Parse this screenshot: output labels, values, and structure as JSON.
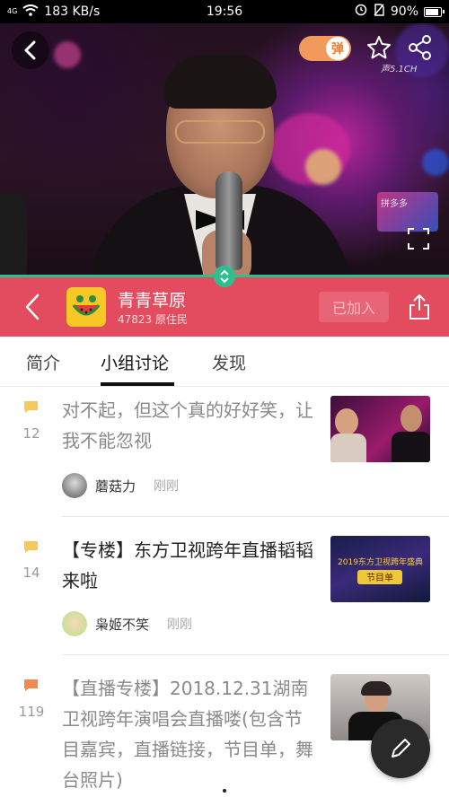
{
  "status_bar": {
    "network_small": "4G",
    "speed": "183 KB/s",
    "time": "19:56",
    "battery_text": "90%",
    "battery_level": 0.9
  },
  "video": {
    "danmaku_label": "弹",
    "channel_mark": "声5.1CH",
    "logo_bug_text": "拼多多"
  },
  "group": {
    "name": "青青草原",
    "members": "47823 原住民",
    "joined_label": "已加入",
    "accent": "#e34b5e"
  },
  "tabs": [
    {
      "label": "简介"
    },
    {
      "label": "小组讨论"
    },
    {
      "label": "发现"
    }
  ],
  "posts": [
    {
      "count": "12",
      "title": "对不起，但这个真的好好笑，让我不能忽视",
      "user": "蘑菇力",
      "time": "刚刚",
      "icon_color": "#f5c95c"
    },
    {
      "count": "14",
      "title": "【专楼】东方卫视跨年直播韬韬来啦",
      "user": "枭姬不笑",
      "time": "刚刚",
      "icon_color": "#f5c95c"
    },
    {
      "count": "119",
      "title": "【直播专楼】2018.12.31湖南卫视跨年演唱会直播喽(包含节目嘉宾，直播链接，节目单，舞台照片)",
      "icon_color": "#f28a54"
    }
  ],
  "thumb_text": {
    "banner": "2019东方卫视跨年盛典",
    "banner_sub": "节目单"
  }
}
